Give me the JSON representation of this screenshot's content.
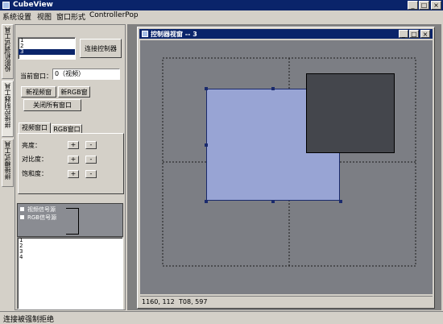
{
  "app": {
    "title": "CubeView"
  },
  "window_controls": {
    "minimize": "_",
    "maximize": "□",
    "close": "×"
  },
  "menu": [
    "系统设置",
    "视图",
    "窗口形式",
    "ControllerPop"
  ],
  "side_tabs": [
    "投影机调试工具",
    "拼接控制器工具",
    "拼接模式工具"
  ],
  "controller_list": {
    "items": [
      "1",
      "2",
      "3"
    ],
    "selected_index": 2
  },
  "connect_button": "连接控制器",
  "current_window": {
    "label": "当前窗口：",
    "value": "0（视频）"
  },
  "buttons": {
    "new_video": "新视频窗",
    "new_rgb": "新RGB窗",
    "close_all": "关闭所有窗口"
  },
  "tabs": [
    "视频窗口",
    "RGB窗口"
  ],
  "adjust": [
    {
      "label": "亮度：",
      "plus": "+",
      "minus": "-"
    },
    {
      "label": "对比度：",
      "plus": "+",
      "minus": "-"
    },
    {
      "label": "饱和度：",
      "plus": "+",
      "minus": "-"
    }
  ],
  "signal_tree": [
    "视频信号源",
    "RGB信号源"
  ],
  "number_list": [
    "1",
    "2",
    "3",
    "4"
  ],
  "child_window": {
    "title": "控制器视窗 -- 3",
    "controls": {
      "minimize": "_",
      "maximize": "□",
      "close": "×"
    },
    "status": {
      "coords": "1160, 112",
      "size": "T08, 597"
    }
  },
  "statusbar": {
    "text": "连接被强制拒绝"
  },
  "colors": {
    "title_bg": "#0a246a",
    "canvas_bg": "#7c7e84",
    "window_light": "#98a4d4",
    "window_dark": "#44464c"
  }
}
